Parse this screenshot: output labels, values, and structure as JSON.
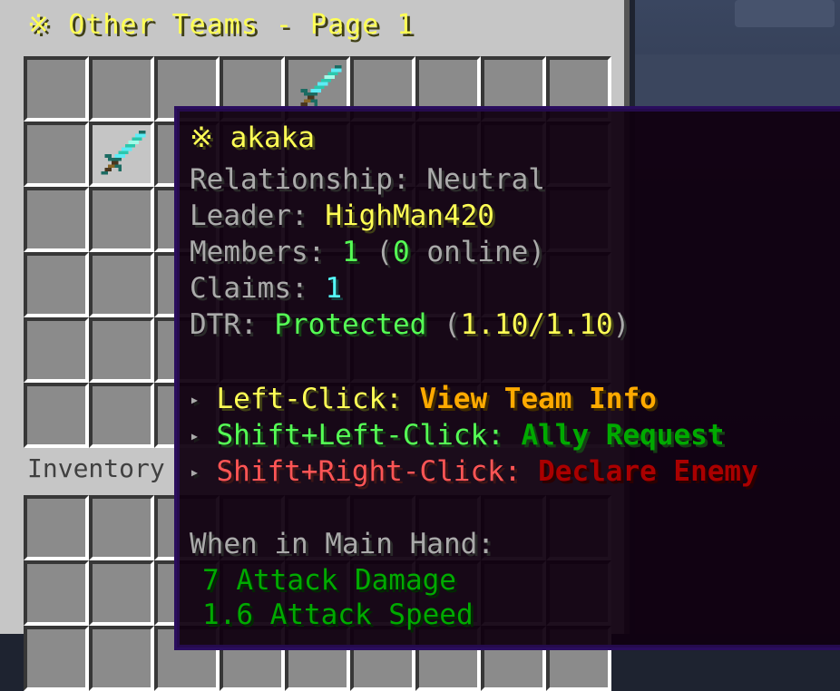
{
  "gui": {
    "title": "※ Other Teams - Page 1",
    "inventory_label": "Inventory",
    "top_grid": {
      "rows": 6,
      "cols": 9,
      "items": [
        {
          "row": 0,
          "col": 4,
          "item": "diamond-sword"
        },
        {
          "row": 1,
          "col": 1,
          "item": "diamond-sword",
          "highlighted": true
        }
      ]
    },
    "inventory_grid": {
      "rows": 3,
      "cols": 9
    }
  },
  "tooltip": {
    "title": "※ akaka",
    "relationship_label": "Relationship: Neutral",
    "leader_label": "Leader: ",
    "leader_name": "HighMan420",
    "members_label": "Members: ",
    "members_count": "1",
    "members_open": " (",
    "members_online": "0",
    "members_close": " online)",
    "claims_label": "Claims: ",
    "claims_count": "1",
    "dtr_label": "DTR: ",
    "dtr_status": "Protected",
    "dtr_open": " (",
    "dtr_value": "1.10/1.10",
    "dtr_close": ")",
    "bullet": "▸",
    "actions": [
      {
        "key": "Left-Click: ",
        "action": "View Team Info"
      },
      {
        "key": "Shift+Left-Click: ",
        "action": "Ally Request"
      },
      {
        "key": "Shift+Right-Click: ",
        "action": "Declare Enemy"
      }
    ],
    "main_hand_label": "When in Main Hand:",
    "attack_damage": "7 Attack Damage",
    "attack_speed": "1.6 Attack Speed"
  },
  "colors": {
    "title_yellow": "#ffff55",
    "gray": "#aaaaaa",
    "green": "#55ff55",
    "aqua": "#55ffff",
    "gold": "#ffaa00",
    "dark_green": "#00aa00",
    "red": "#ff5555",
    "dark_red": "#aa0000",
    "tooltip_bg": "#100010",
    "tooltip_border": "#2a0d5e"
  }
}
